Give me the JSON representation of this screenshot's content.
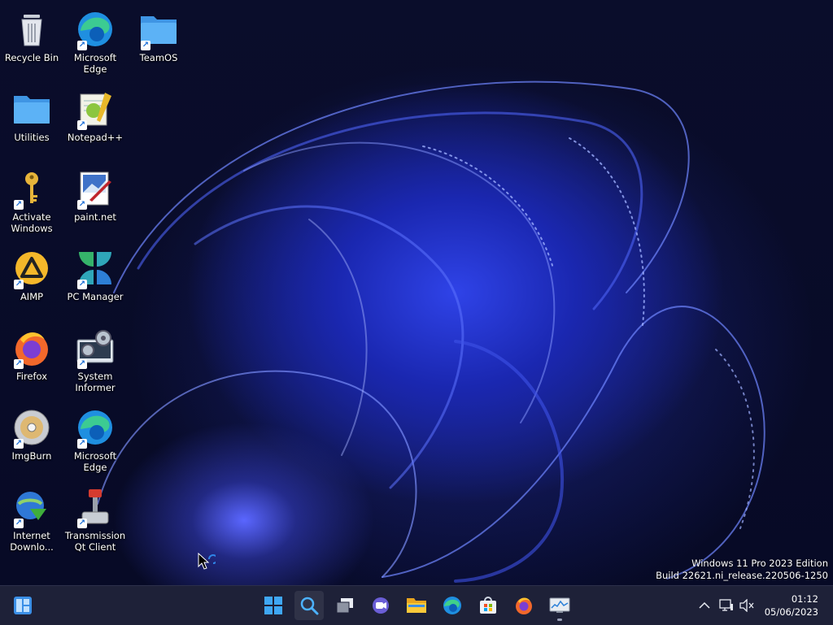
{
  "desktop": {
    "icons": [
      {
        "label": "Recycle Bin",
        "icon": "recycle-bin-icon"
      },
      {
        "label": "Microsoft Edge",
        "icon": "edge-icon"
      },
      {
        "label": "TeamOS",
        "icon": "folder-icon"
      },
      {
        "label": "Utilities",
        "icon": "folder-icon"
      },
      {
        "label": "Notepad++",
        "icon": "notepad-plus-plus-icon"
      },
      {
        "label": "Activate Windows",
        "icon": "key-icon"
      },
      {
        "label": "paint.net",
        "icon": "paint-net-icon"
      },
      {
        "label": "AIMP",
        "icon": "aimp-icon"
      },
      {
        "label": "PC Manager",
        "icon": "pc-manager-icon"
      },
      {
        "label": "Firefox",
        "icon": "firefox-icon"
      },
      {
        "label": "System Informer",
        "icon": "system-informer-icon"
      },
      {
        "label": "ImgBurn",
        "icon": "imgburn-icon"
      },
      {
        "label": "Microsoft Edge",
        "icon": "edge-icon"
      },
      {
        "label": "Internet Downlo...",
        "icon": "internet-download-manager-icon"
      },
      {
        "label": "Transmission Qt Client",
        "icon": "transmission-icon"
      }
    ],
    "watermark": {
      "line1": "Windows 11 Pro 2023 Edition",
      "line2": "Build 22621.ni_release.220506-1250"
    }
  },
  "taskbar": {
    "widgets_icon": "widgets-icon",
    "apps": [
      {
        "icon": "start-icon"
      },
      {
        "icon": "search-icon"
      },
      {
        "icon": "task-view-icon"
      },
      {
        "icon": "chat-icon"
      },
      {
        "icon": "file-explorer-icon"
      },
      {
        "icon": "edge-icon"
      },
      {
        "icon": "store-icon"
      },
      {
        "icon": "firefox-icon"
      },
      {
        "icon": "resource-monitor-icon"
      }
    ],
    "tray": {
      "overflow_icon": "chevron-up-icon",
      "network_icon": "network-icon",
      "volume_icon": "volume-muted-icon"
    },
    "clock": {
      "time": "01:12",
      "date": "05/06/2023"
    }
  },
  "colors": {
    "taskbar": "#1e2138",
    "wallpaper_base": "#070a26",
    "wallpaper_accent": "#2f43e8",
    "folder": "#4ba3f0"
  }
}
